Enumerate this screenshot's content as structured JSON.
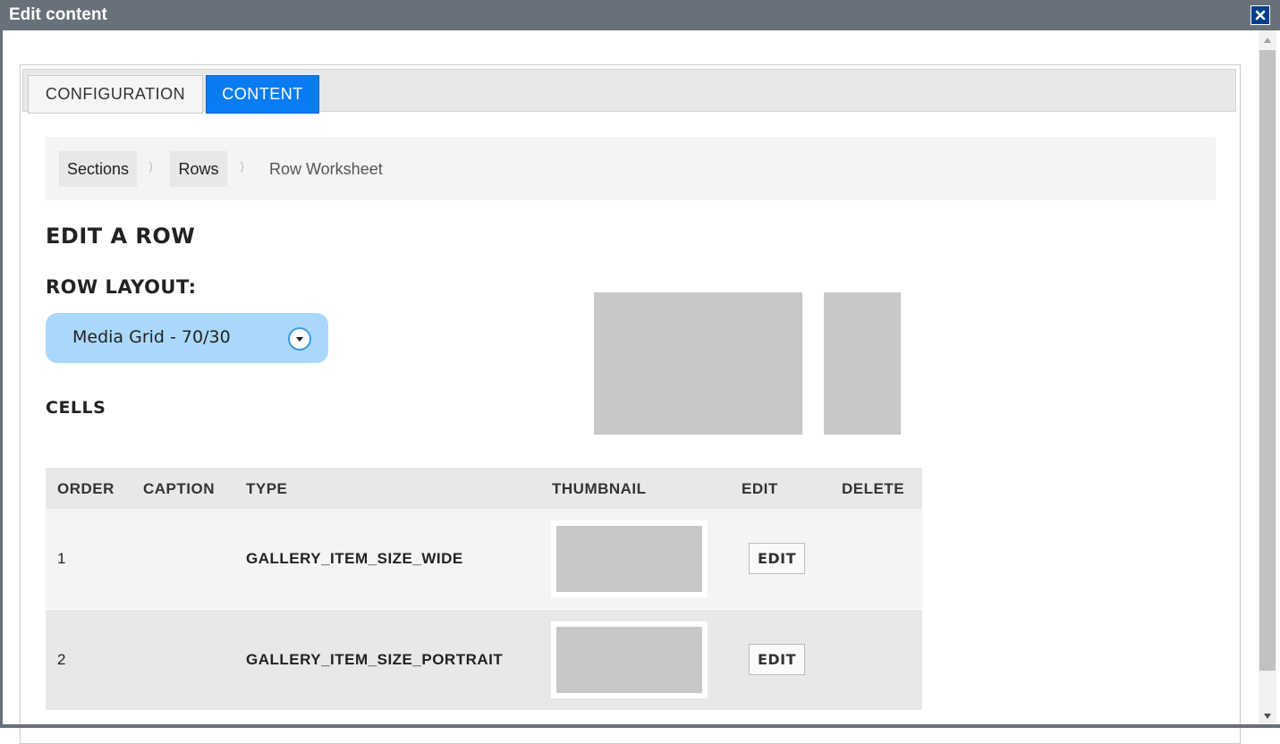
{
  "window": {
    "title": "Edit content",
    "close_icon": "close-icon"
  },
  "tabs": [
    {
      "label": "CONFIGURATION",
      "active": false
    },
    {
      "label": "CONTENT",
      "active": true
    }
  ],
  "breadcrumb": {
    "items": [
      "Sections",
      "Rows"
    ],
    "separator": "⟩",
    "current": "Row Worksheet"
  },
  "page": {
    "title": "EDIT A ROW",
    "layout_label": "ROW LAYOUT:",
    "layout_value": "Media Grid - 70/30",
    "cells_label": "CELLS"
  },
  "table": {
    "headers": [
      "ORDER",
      "CAPTION",
      "TYPE",
      "THUMBNAIL",
      "EDIT",
      "DELETE"
    ],
    "rows": [
      {
        "order": "1",
        "caption": "",
        "type": "GALLERY_ITEM_SIZE_WIDE",
        "edit_label": "EDIT"
      },
      {
        "order": "2",
        "caption": "",
        "type": "GALLERY_ITEM_SIZE_PORTRAIT",
        "edit_label": "EDIT"
      }
    ]
  },
  "colors": {
    "titlebar": "#68707a",
    "active_tab": "#0a7cf2",
    "select_bg": "#aad8fa",
    "placeholder": "#c8c8c8"
  }
}
